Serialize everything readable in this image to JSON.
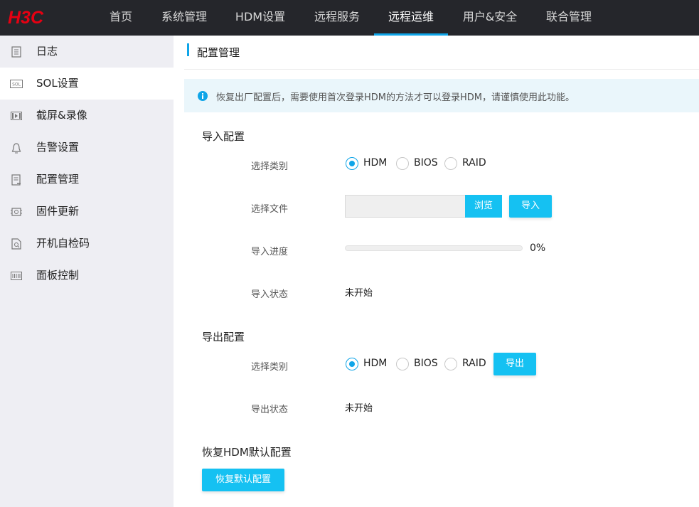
{
  "brand": {
    "logo_text": "H3C",
    "logo_color": "#e60012"
  },
  "nav": {
    "items": [
      {
        "label": "首页"
      },
      {
        "label": "系统管理"
      },
      {
        "label": "HDM设置"
      },
      {
        "label": "远程服务"
      },
      {
        "label": "远程运维",
        "active": true
      },
      {
        "label": "用户&安全"
      },
      {
        "label": "联合管理"
      }
    ]
  },
  "sidebar": {
    "items": [
      {
        "label": "日志",
        "icon": "log-icon"
      },
      {
        "label": "SOL设置",
        "icon": "sol-icon",
        "icon_text": "SOL"
      },
      {
        "label": "截屏&录像",
        "icon": "video-icon"
      },
      {
        "label": "告警设置",
        "icon": "alarm-icon"
      },
      {
        "label": "配置管理",
        "icon": "config-icon",
        "active": true
      },
      {
        "label": "固件更新",
        "icon": "firmware-icon"
      },
      {
        "label": "开机自检码",
        "icon": "post-code-icon"
      },
      {
        "label": "面板控制",
        "icon": "panel-icon"
      }
    ]
  },
  "page": {
    "title": "配置管理",
    "notice": "恢复出厂配置后，需要使用首次登录HDM的方法才可以登录HDM，请谨慎使用此功能。"
  },
  "import": {
    "section_title": "导入配置",
    "type_label": "选择类别",
    "options": [
      "HDM",
      "BIOS",
      "RAID"
    ],
    "selected": "HDM",
    "file_label": "选择文件",
    "file_value": "",
    "browse_label": "浏览",
    "import_label": "导入",
    "progress_label": "导入进度",
    "progress_value": 0,
    "progress_text": "0%",
    "status_label": "导入状态",
    "status_value": "未开始"
  },
  "export": {
    "section_title": "导出配置",
    "type_label": "选择类别",
    "options": [
      "HDM",
      "BIOS",
      "RAID"
    ],
    "selected": "HDM",
    "export_label": "导出",
    "status_label": "导出状态",
    "status_value": "未开始"
  },
  "restore": {
    "section_title": "恢复HDM默认配置",
    "button_label": "恢复默认配置"
  },
  "colors": {
    "accent": "#0fa5e8",
    "button": "#15c1f2",
    "topbar": "#25262b",
    "sidebar": "#eeeef3"
  }
}
